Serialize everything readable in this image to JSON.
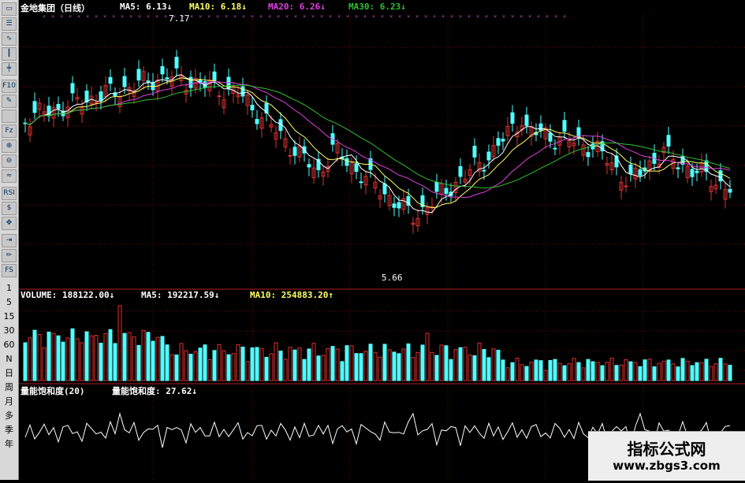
{
  "toolbar": {
    "icons": [
      "window-icon",
      "list-icon",
      "line-chart-icon",
      "candlestick-icon",
      "k-line-icon",
      "f10-icon",
      "note-icon",
      "f-icon",
      "fz-icon",
      "zoom-in-icon",
      "zoom-out-icon",
      "indicator-icon",
      "rsi-icon",
      "dollar-icon",
      "move-icon",
      "export-icon",
      "pencil-icon",
      "fs-icon"
    ],
    "labels": {
      "f10": "F10",
      "fz": "Fz",
      "rsi": "RSI",
      "fs": "FS"
    },
    "periods": [
      "1",
      "5",
      "15",
      "30",
      "60",
      "N",
      "日",
      "周",
      "月",
      "多",
      "季",
      "年"
    ]
  },
  "main": {
    "title": "金地集团（日线）",
    "ma5": "MA5: 6.13↓",
    "ma10": "MA10: 6.18↓",
    "ma20": "MA20: 6.26↓",
    "ma30": "MA30: 6.23↓",
    "high_label": "7.17",
    "low_label": "5.66"
  },
  "volume": {
    "volume": "VOLUME: 188122.00↓",
    "ma5": "MA5: 192217.59↓",
    "ma10": "MA10: 254883.20↑"
  },
  "indicator": {
    "name": "量能饱和度(20)",
    "value": "量能饱和度: 27.62↓"
  },
  "watermark": {
    "line1": "指标公式网",
    "line2": "www.zbgs3.com"
  },
  "colors": {
    "up": "#e03030",
    "down": "#50ffff",
    "ma5": "#ffffff",
    "ma10": "#ffff66",
    "ma20": "#e040e0",
    "ma30": "#30c030",
    "grid": "#800000",
    "bg": "#000000"
  }
}
